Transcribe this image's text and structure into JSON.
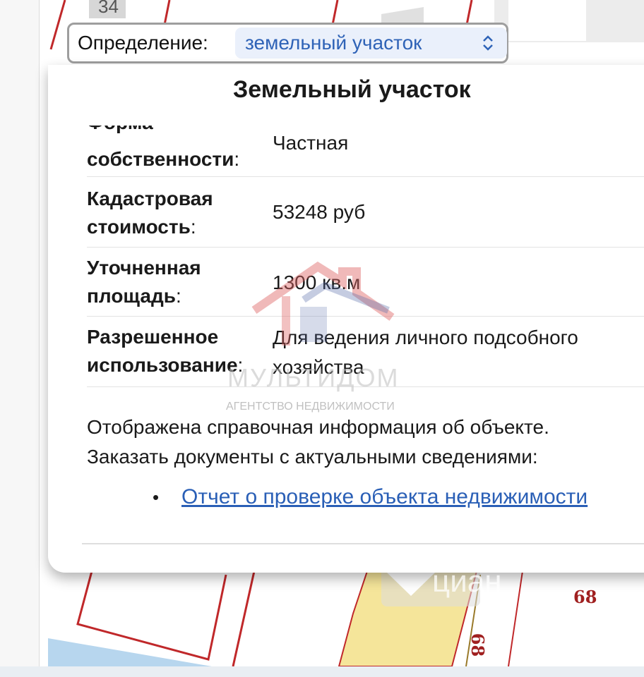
{
  "map": {
    "top_plot_number": "34",
    "plot_number_right": "68",
    "plot_number_vertical": "68",
    "watermark_corner": "циан"
  },
  "definition": {
    "label": "Определение:",
    "selected": "земельный участок"
  },
  "popup": {
    "title": "Земельный участок",
    "clipped_label_top": "Форма",
    "rows": [
      {
        "label_line1": "",
        "label_line2": "собственности",
        "value": "Частная"
      },
      {
        "label_line1": "Кадастровая",
        "label_line2": "стоимость",
        "value": "53248 руб"
      },
      {
        "label_line1": "Уточненная",
        "label_line2": "площадь",
        "value": "1300 кв.м"
      },
      {
        "label_line1": "Разрешенное",
        "label_line2": "использование",
        "value_line1": "Для ведения личного подсобного",
        "value_line2": "хозяйства"
      }
    ],
    "colon": ":",
    "info_line1": "Отображена справочная информация об объекте.",
    "info_line2": "Заказать документы с актуальными сведениями:",
    "bullet": "•",
    "report_link": "Отчет о проверке объекта недвижимости"
  },
  "agency_watermark": {
    "name": "МУЛЬТИДОМ",
    "subtitle": "АГЕНТСТВО НЕДВИЖИМОСТИ"
  },
  "colors": {
    "link": "#2a5fb6",
    "select_bg": "#eaf0fb",
    "plot_border": "#c0282a",
    "highlight_plot": "#f5e59a"
  }
}
